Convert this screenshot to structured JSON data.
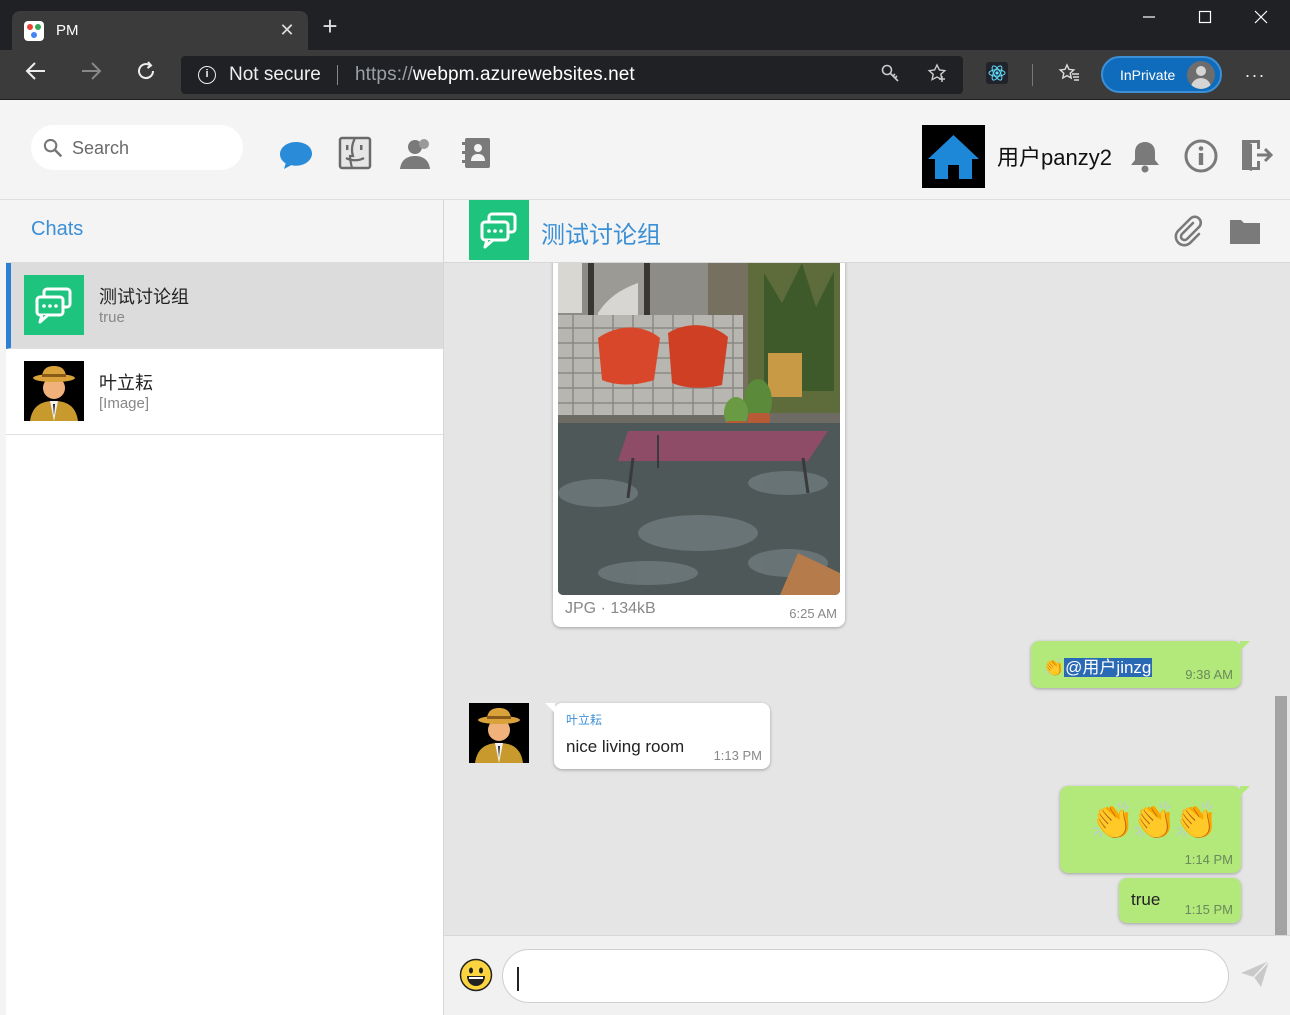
{
  "browser": {
    "tab_title": "PM",
    "tab_close_icon": "close-icon",
    "new_tab_symbol": "+",
    "security_text": "Not secure",
    "url_protocol": "https://",
    "url_host": "webpm.azurewebsites.net",
    "inprivate_label": "InPrivate",
    "more_symbol": "···"
  },
  "header": {
    "search_placeholder": "Search",
    "username": "用户panzy2",
    "nav_icons": [
      "chat-bubble-icon",
      "finder-icon",
      "contacts-icon",
      "address-book-icon"
    ],
    "right_icons": [
      "bell-icon",
      "info-icon",
      "logout-icon"
    ]
  },
  "sidebar": {
    "title": "Chats",
    "chats": [
      {
        "name": "测试讨论组",
        "preview": "true",
        "active": true
      },
      {
        "name": "叶立耘",
        "preview": "[Image]",
        "active": false
      }
    ]
  },
  "conversation": {
    "title": "测试讨论组",
    "messages": {
      "image": {
        "file_meta": "JPG · 134kB",
        "time": "6:25 AM"
      },
      "mention": {
        "emoji": "👏",
        "mention": "@用户jinzg",
        "time": "9:38 AM"
      },
      "peer": {
        "sender": "叶立耘",
        "text": "nice living room",
        "time": "1:13 PM"
      },
      "claps": {
        "text": "👏👏👏",
        "time": "1:14 PM"
      },
      "true_msg": {
        "text": "true",
        "time": "1:15 PM"
      }
    }
  },
  "colors": {
    "accent": "#3b8fd6",
    "outgoing_bubble": "#b3e87a",
    "group_green": "#1ec47e"
  }
}
